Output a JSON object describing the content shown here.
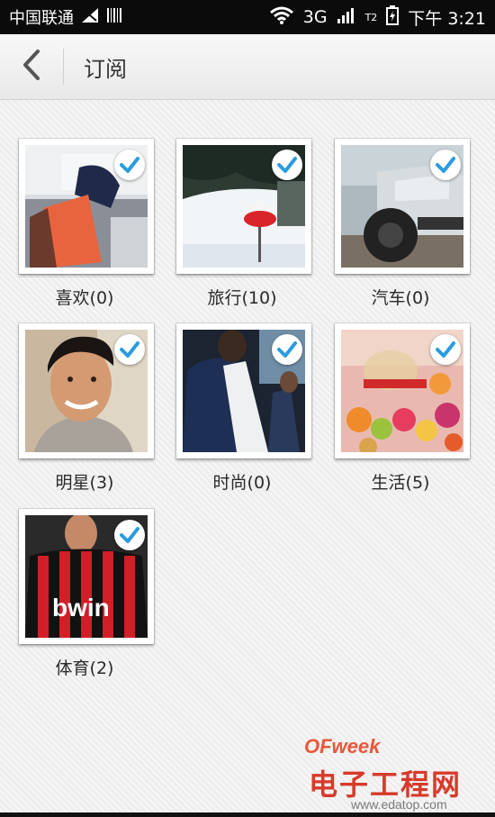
{
  "status_bar": {
    "carrier": "中国联通",
    "network": "3G",
    "sim2": "T2",
    "time": "下午 3:21",
    "icons": [
      "signal-off-icon",
      "barcode-icon",
      "wifi-icon",
      "signal-bars-icon",
      "battery-icon"
    ]
  },
  "header": {
    "title": "订阅",
    "back_icon": "chevron-left-icon"
  },
  "categories": [
    {
      "label": "喜欢(0)",
      "selected": true
    },
    {
      "label": "旅行(10)",
      "selected": true
    },
    {
      "label": "汽车(0)",
      "selected": true
    },
    {
      "label": "明星(3)",
      "selected": true
    },
    {
      "label": "时尚(0)",
      "selected": true
    },
    {
      "label": "生活(5)",
      "selected": true
    },
    {
      "label": "体育(2)",
      "selected": true
    }
  ],
  "watermark": {
    "brand": "OFweek",
    "name": "电子工程网",
    "url": "www.edatop.com"
  },
  "colors": {
    "check_blue": "#2b9be0",
    "status_bar": "#0b0b0b",
    "watermark_red": "#d83a2a"
  }
}
